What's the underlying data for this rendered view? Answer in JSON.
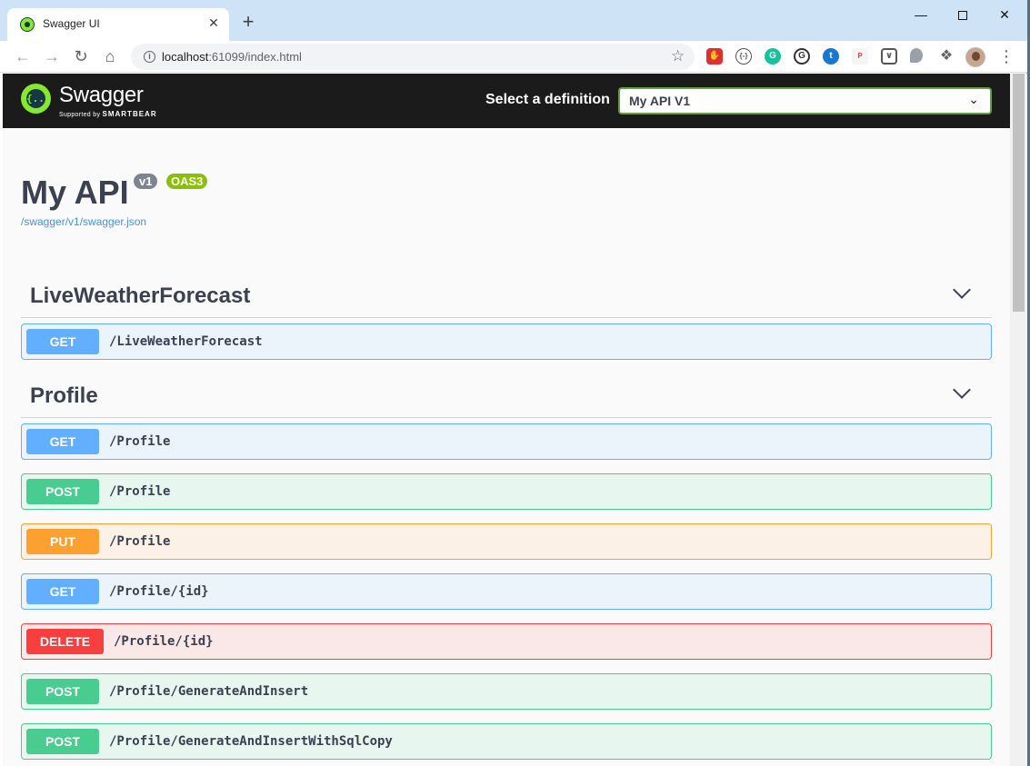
{
  "browser": {
    "tab_title": "Swagger UI",
    "tab_close": "✕",
    "new_tab": "+",
    "url_host": "localhost",
    "url_path": ":61099/index.html",
    "icons": [
      "arrow-left-icon",
      "arrow-right-icon",
      "reload-icon",
      "home-icon",
      "info-icon",
      "star-icon",
      "extension-icons",
      "avatar",
      "menu-dots-icon"
    ]
  },
  "swagger": {
    "logo_name": "Swagger",
    "logo_sub_prefix": "Supported by",
    "logo_sub_brand": "SMARTBEAR",
    "definition_label": "Select a definition",
    "definition_value": "My API V1"
  },
  "info": {
    "title": "My API",
    "version_badge": "v1",
    "oas_badge": "OAS3",
    "spec_link": "/swagger/v1/swagger.json"
  },
  "sections": [
    {
      "title": "LiveWeatherForecast",
      "operations": [
        {
          "method": "GET",
          "path": "/LiveWeatherForecast"
        }
      ]
    },
    {
      "title": "Profile",
      "operations": [
        {
          "method": "GET",
          "path": "/Profile"
        },
        {
          "method": "POST",
          "path": "/Profile"
        },
        {
          "method": "PUT",
          "path": "/Profile"
        },
        {
          "method": "GET",
          "path": "/Profile/{id}"
        },
        {
          "method": "DELETE",
          "path": "/Profile/{id}"
        },
        {
          "method": "POST",
          "path": "/Profile/GenerateAndInsert"
        },
        {
          "method": "POST",
          "path": "/Profile/GenerateAndInsertWithSqlCopy"
        }
      ]
    }
  ],
  "colors": {
    "get": "#61affe",
    "post": "#49cc90",
    "put": "#fca130",
    "delete": "#f93e3e",
    "swagger_green": "#85ea2d"
  }
}
